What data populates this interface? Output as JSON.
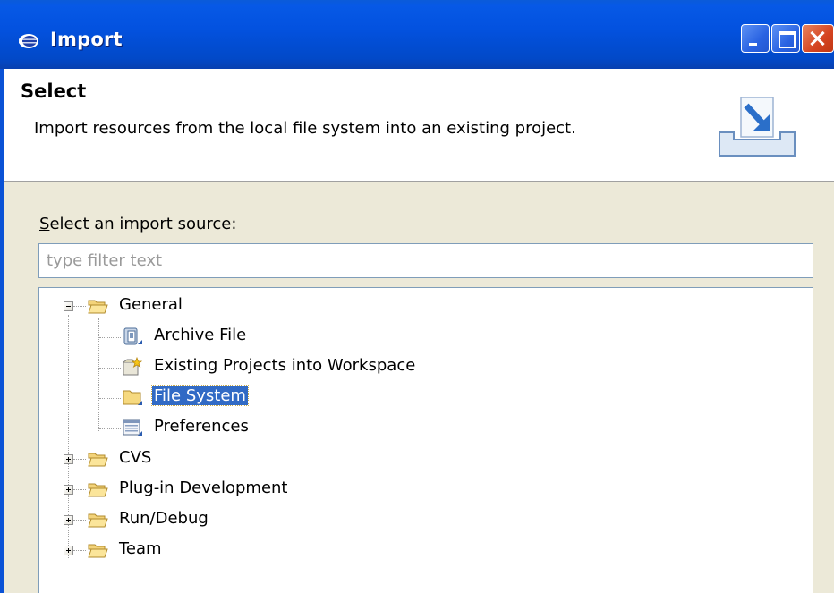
{
  "window": {
    "title": "Import"
  },
  "header": {
    "title": "Select",
    "description": "Import resources from the local file system into an existing project."
  },
  "source": {
    "label_mnemonic": "S",
    "label_rest": "elect an import source:",
    "filter_placeholder": "type filter text"
  },
  "tree": {
    "general": {
      "label": "General",
      "expanded": true
    },
    "children": [
      {
        "label": "Archive File",
        "icon": "archive-file-icon"
      },
      {
        "label": "Existing Projects into Workspace",
        "icon": "existing-project-icon"
      },
      {
        "label": "File System",
        "icon": "file-system-folder-icon",
        "selected": true
      },
      {
        "label": "Preferences",
        "icon": "preferences-icon"
      }
    ],
    "collapsed": [
      "CVS",
      "Plug-in Development",
      "Run/Debug",
      "Team"
    ]
  }
}
